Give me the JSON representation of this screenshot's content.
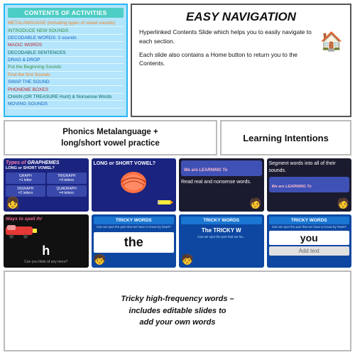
{
  "contents": {
    "title": "CONTENTS OF ACTIVITIES",
    "items": [
      {
        "text": "METALANGUAGE (including types of vowel sounds)",
        "color": "yellow"
      },
      {
        "text": "INTRODUCE NEW SOUNDS",
        "color": "green"
      },
      {
        "text": "DECODABLE WORDS: 3 sounds",
        "color": "blue"
      },
      {
        "text": "MAGIC WORDS",
        "color": "red"
      },
      {
        "text": "DECODABLE SENTENCES",
        "color": "teal"
      },
      {
        "text": "DRAG & DROP",
        "color": "blue"
      },
      {
        "text": "Put the Beginning Sounds",
        "color": "green"
      },
      {
        "text": "Find the first Sounds",
        "color": "yellow"
      },
      {
        "text": "SWAP THE SOUND",
        "color": "blue"
      },
      {
        "text": "PHONEME BOXES",
        "color": "red"
      },
      {
        "text": "CHAIN (OR TREASURE Hunt) & Nonsense Words",
        "color": "teal"
      },
      {
        "text": "MOVING SOUNDS",
        "color": "blue"
      }
    ]
  },
  "easy_nav": {
    "title": "EASY NAVIGATION",
    "para1": "Hyperlinked Contents Slide which helps you to easily navigate to each section.",
    "para2": "Each slide also contains a Home button to return you to the Contents.",
    "house_icon": "🏠"
  },
  "phonics": {
    "title": "Phonics Metalanguage +\nlong/short vowel practice"
  },
  "learning_intentions": {
    "title": "Learning Intentions"
  },
  "thumbnails_row1": [
    {
      "id": "graphemes",
      "bg": "dark-blue",
      "title": "Types of GRAPHEMES",
      "subtitle": "LONG or SHORT VOWEL?",
      "boxes": [
        {
          "label": "GRAPH\n=1 letter"
        },
        {
          "label": "TRIGRAPH\n=3 letters"
        },
        {
          "label": "DIGRAPH\n=2 letters"
        },
        {
          "label": "QUADRAPH\n=4 letters"
        }
      ]
    },
    {
      "id": "long-short",
      "bg": "dark-blue",
      "title": "LONG or SHORT VOWEL?",
      "has_shell": true
    },
    {
      "id": "li1",
      "bg": "dark",
      "learn_label": "We are LEARNING To",
      "text": "Read real and nonsense words."
    },
    {
      "id": "li2",
      "bg": "dark",
      "learn_label": "We are LEARNING To",
      "text": "Segment words into all of their sounds."
    }
  ],
  "thumbnails_row2": [
    {
      "id": "ways-spell",
      "bg": "black",
      "title": "Ways to spell /h/",
      "letter": "h",
      "sub": "Can you think of any more?"
    },
    {
      "id": "tricky1",
      "bg": "blue-dark",
      "header": "TRICKY WORDS",
      "sub": "Can we spot the part that we have to know by heart?",
      "word": "the"
    },
    {
      "id": "tricky2",
      "bg": "blue-dark",
      "header": "TRICKY WORDS",
      "word": "The TRICKY W...",
      "sub2": "Can we spot the part that we ha..."
    },
    {
      "id": "tricky3",
      "bg": "blue-dark",
      "header": "TRICKY WORDS",
      "sub": "Can we spot the part that we have to know by heart?",
      "word": "you",
      "addtext": "Add text"
    }
  ],
  "bottom": {
    "tricky_desc": "Tricky high-frequency words –\nincludes editable slides to\nadd your own words"
  }
}
